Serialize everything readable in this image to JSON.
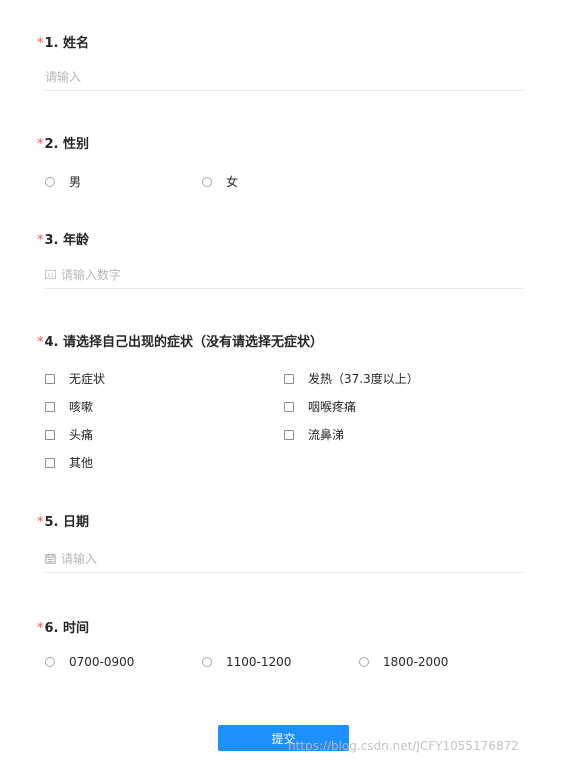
{
  "form": {
    "q1": {
      "required_mark": "*",
      "title": "1. 姓名",
      "placeholder": "请输入"
    },
    "q2": {
      "required_mark": "*",
      "title": "2. 性别",
      "options": [
        "男",
        "女"
      ]
    },
    "q3": {
      "required_mark": "*",
      "title": "3. 年龄",
      "placeholder": "请输入数字",
      "icon": "number-icon"
    },
    "q4": {
      "required_mark": "*",
      "title": "4. 请选择自己出现的症状（没有请选择无症状）",
      "options": [
        "无症状",
        "发热（37.3度以上）",
        "咳嗽",
        "咽喉疼痛",
        "头痛",
        "流鼻涕",
        "其他"
      ]
    },
    "q5": {
      "required_mark": "*",
      "title": "5. 日期",
      "placeholder": "请输入",
      "icon": "calendar-icon"
    },
    "q6": {
      "required_mark": "*",
      "title": "6. 时间",
      "options": [
        "0700-0900",
        "1100-1200",
        "1800-2000"
      ]
    },
    "submit_label": "提交"
  },
  "watermark": "https://blog.csdn.net/JCFY1055176872",
  "colors": {
    "required": "#ff4d4f",
    "primary": "#1e8fff",
    "placeholder": "#b8b8b8"
  }
}
